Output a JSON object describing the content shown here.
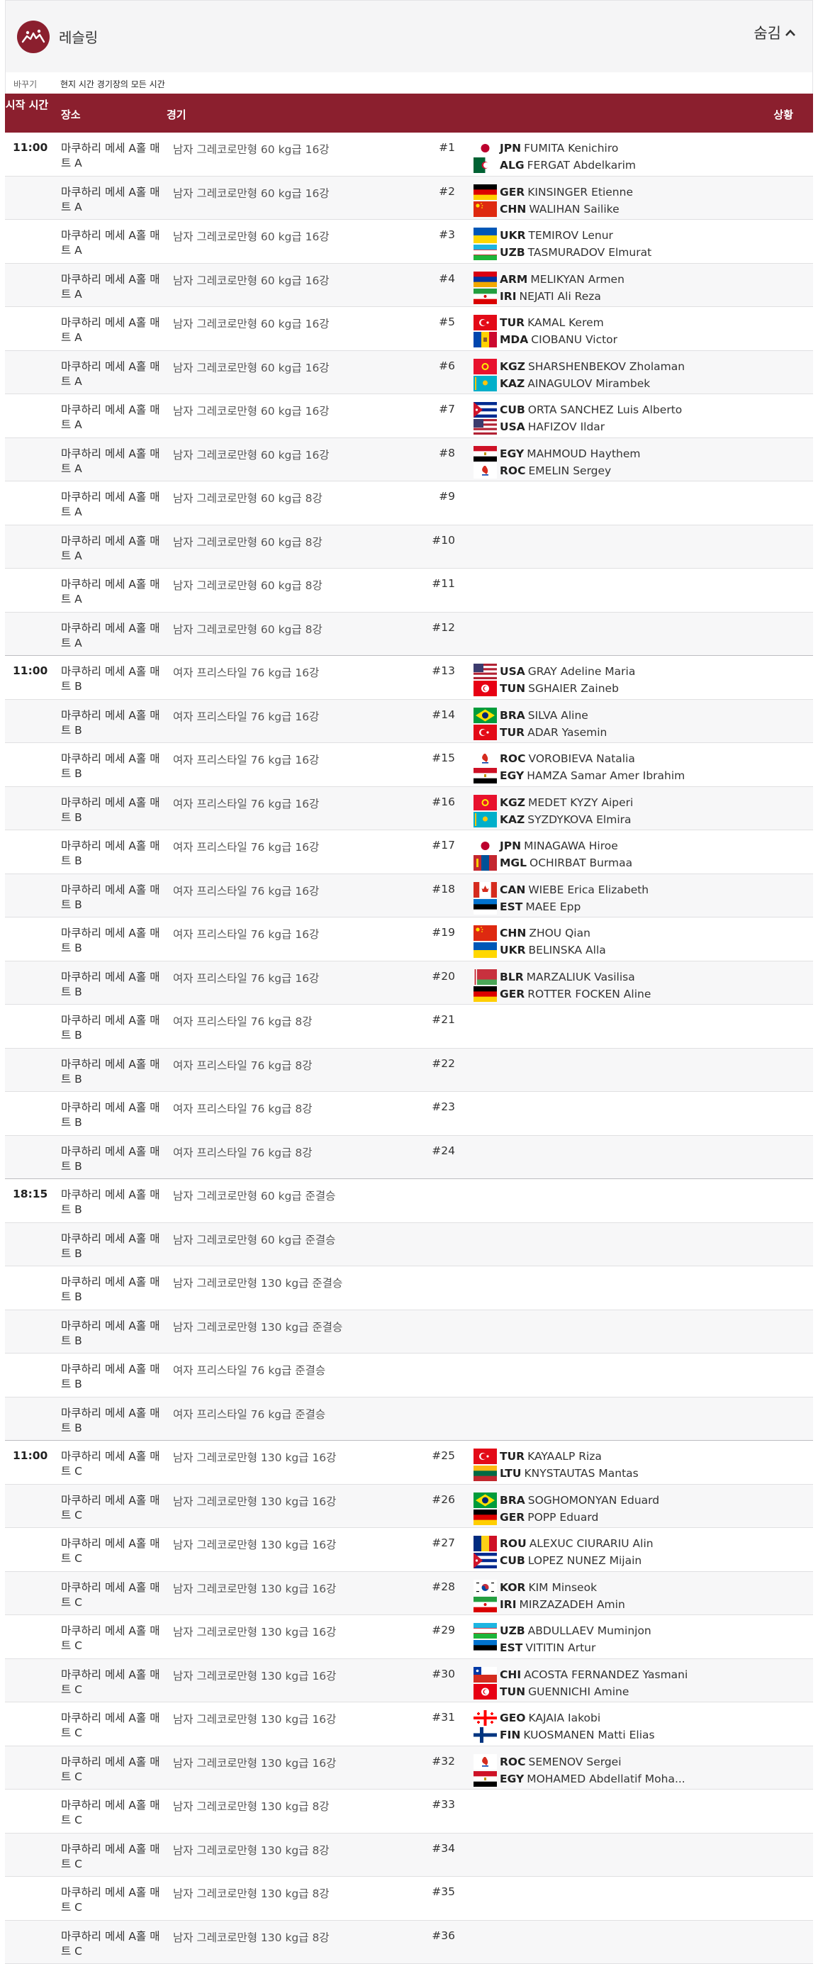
{
  "header": {
    "sport_title": "레슬링",
    "hide_label": "숨김"
  },
  "subbar": {
    "change_label": "바꾸기",
    "timezone_label": "현지 시간 경기장의 모든 시간"
  },
  "table": {
    "headers": {
      "time": "시작 시간",
      "venue": "장소",
      "event": "경기",
      "status": "상황"
    },
    "rows": [
      {
        "time": "11:00",
        "venue": "마쿠하리 메세 A홀 매트 A",
        "event": "남자 그레코로만형 60 kg급 16강",
        "num": "#1",
        "competitors": [
          {
            "flag": "JPN",
            "code": "JPN",
            "name": "FUMITA Kenichiro"
          },
          {
            "flag": "ALG",
            "code": "ALG",
            "name": "FERGAT Abdelkarim"
          }
        ]
      },
      {
        "time": "",
        "venue": "마쿠하리 메세 A홀 매트 A",
        "event": "남자 그레코로만형 60 kg급 16강",
        "num": "#2",
        "competitors": [
          {
            "flag": "GER",
            "code": "GER",
            "name": "KINSINGER Etienne"
          },
          {
            "flag": "CHN",
            "code": "CHN",
            "name": "WALIHAN Sailike"
          }
        ]
      },
      {
        "time": "",
        "venue": "마쿠하리 메세 A홀 매트 A",
        "event": "남자 그레코로만형 60 kg급 16강",
        "num": "#3",
        "competitors": [
          {
            "flag": "UKR",
            "code": "UKR",
            "name": "TEMIROV Lenur"
          },
          {
            "flag": "UZB",
            "code": "UZB",
            "name": "TASMURADOV Elmurat"
          }
        ]
      },
      {
        "time": "",
        "venue": "마쿠하리 메세 A홀 매트 A",
        "event": "남자 그레코로만형 60 kg급 16강",
        "num": "#4",
        "competitors": [
          {
            "flag": "ARM",
            "code": "ARM",
            "name": "MELIKYAN Armen"
          },
          {
            "flag": "IRI",
            "code": "IRI",
            "name": "NEJATI Ali Reza"
          }
        ]
      },
      {
        "time": "",
        "venue": "마쿠하리 메세 A홀 매트 A",
        "event": "남자 그레코로만형 60 kg급 16강",
        "num": "#5",
        "competitors": [
          {
            "flag": "TUR",
            "code": "TUR",
            "name": "KAMAL Kerem"
          },
          {
            "flag": "MDA",
            "code": "MDA",
            "name": "CIOBANU Victor"
          }
        ]
      },
      {
        "time": "",
        "venue": "마쿠하리 메세 A홀 매트 A",
        "event": "남자 그레코로만형 60 kg급 16강",
        "num": "#6",
        "competitors": [
          {
            "flag": "KGZ",
            "code": "KGZ",
            "name": "SHARSHENBEKOV Zholaman"
          },
          {
            "flag": "KAZ",
            "code": "KAZ",
            "name": "AINAGULOV Mirambek"
          }
        ]
      },
      {
        "time": "",
        "venue": "마쿠하리 메세 A홀 매트 A",
        "event": "남자 그레코로만형 60 kg급 16강",
        "num": "#7",
        "competitors": [
          {
            "flag": "CUB",
            "code": "CUB",
            "name": "ORTA SANCHEZ Luis Alberto"
          },
          {
            "flag": "USA",
            "code": "USA",
            "name": "HAFIZOV Ildar"
          }
        ]
      },
      {
        "time": "",
        "venue": "마쿠하리 메세 A홀 매트 A",
        "event": "남자 그레코로만형 60 kg급 16강",
        "num": "#8",
        "competitors": [
          {
            "flag": "EGY",
            "code": "EGY",
            "name": "MAHMOUD Haythem"
          },
          {
            "flag": "ROC",
            "code": "ROC",
            "name": "EMELIN Sergey"
          }
        ]
      },
      {
        "time": "",
        "venue": "마쿠하리 메세 A홀 매트 A",
        "event": "남자 그레코로만형 60 kg급 8강",
        "num": "#9",
        "competitors": []
      },
      {
        "time": "",
        "venue": "마쿠하리 메세 A홀 매트 A",
        "event": "남자 그레코로만형 60 kg급 8강",
        "num": "#10",
        "competitors": []
      },
      {
        "time": "",
        "venue": "마쿠하리 메세 A홀 매트 A",
        "event": "남자 그레코로만형 60 kg급 8강",
        "num": "#11",
        "competitors": []
      },
      {
        "time": "",
        "venue": "마쿠하리 메세 A홀 매트 A",
        "event": "남자 그레코로만형 60 kg급 8강",
        "num": "#12",
        "competitors": []
      },
      {
        "time": "11:00",
        "venue": "마쿠하리 메세 A홀 매트 B",
        "event": "여자 프리스타일 76 kg급 16강",
        "num": "#13",
        "competitors": [
          {
            "flag": "USA",
            "code": "USA",
            "name": "GRAY Adeline Maria"
          },
          {
            "flag": "TUN",
            "code": "TUN",
            "name": "SGHAIER Zaineb"
          }
        ]
      },
      {
        "time": "",
        "venue": "마쿠하리 메세 A홀 매트 B",
        "event": "여자 프리스타일 76 kg급 16강",
        "num": "#14",
        "competitors": [
          {
            "flag": "BRA",
            "code": "BRA",
            "name": "SILVA Aline"
          },
          {
            "flag": "TUR",
            "code": "TUR",
            "name": "ADAR Yasemin"
          }
        ]
      },
      {
        "time": "",
        "venue": "마쿠하리 메세 A홀 매트 B",
        "event": "여자 프리스타일 76 kg급 16강",
        "num": "#15",
        "competitors": [
          {
            "flag": "ROC",
            "code": "ROC",
            "name": "VOROBIEVA Natalia"
          },
          {
            "flag": "EGY",
            "code": "EGY",
            "name": "HAMZA Samar Amer Ibrahim"
          }
        ]
      },
      {
        "time": "",
        "venue": "마쿠하리 메세 A홀 매트 B",
        "event": "여자 프리스타일 76 kg급 16강",
        "num": "#16",
        "competitors": [
          {
            "flag": "KGZ",
            "code": "KGZ",
            "name": "MEDET KYZY Aiperi"
          },
          {
            "flag": "KAZ",
            "code": "KAZ",
            "name": "SYZDYKOVA Elmira"
          }
        ]
      },
      {
        "time": "",
        "venue": "마쿠하리 메세 A홀 매트 B",
        "event": "여자 프리스타일 76 kg급 16강",
        "num": "#17",
        "competitors": [
          {
            "flag": "JPN",
            "code": "JPN",
            "name": "MINAGAWA Hiroe"
          },
          {
            "flag": "MGL",
            "code": "MGL",
            "name": "OCHIRBAT Burmaa"
          }
        ]
      },
      {
        "time": "",
        "venue": "마쿠하리 메세 A홀 매트 B",
        "event": "여자 프리스타일 76 kg급 16강",
        "num": "#18",
        "competitors": [
          {
            "flag": "CAN",
            "code": "CAN",
            "name": "WIEBE Erica Elizabeth"
          },
          {
            "flag": "EST",
            "code": "EST",
            "name": "MAEE Epp"
          }
        ]
      },
      {
        "time": "",
        "venue": "마쿠하리 메세 A홀 매트 B",
        "event": "여자 프리스타일 76 kg급 16강",
        "num": "#19",
        "competitors": [
          {
            "flag": "CHN",
            "code": "CHN",
            "name": "ZHOU Qian"
          },
          {
            "flag": "UKR",
            "code": "UKR",
            "name": "BELINSKA Alla"
          }
        ]
      },
      {
        "time": "",
        "venue": "마쿠하리 메세 A홀 매트 B",
        "event": "여자 프리스타일 76 kg급 16강",
        "num": "#20",
        "competitors": [
          {
            "flag": "BLR",
            "code": "BLR",
            "name": "MARZALIUK Vasilisa"
          },
          {
            "flag": "GER",
            "code": "GER",
            "name": "ROTTER FOCKEN Aline"
          }
        ]
      },
      {
        "time": "",
        "venue": "마쿠하리 메세 A홀 매트 B",
        "event": "여자 프리스타일 76 kg급 8강",
        "num": "#21",
        "competitors": []
      },
      {
        "time": "",
        "venue": "마쿠하리 메세 A홀 매트 B",
        "event": "여자 프리스타일 76 kg급 8강",
        "num": "#22",
        "competitors": []
      },
      {
        "time": "",
        "venue": "마쿠하리 메세 A홀 매트 B",
        "event": "여자 프리스타일 76 kg급 8강",
        "num": "#23",
        "competitors": []
      },
      {
        "time": "",
        "venue": "마쿠하리 메세 A홀 매트 B",
        "event": "여자 프리스타일 76 kg급 8강",
        "num": "#24",
        "competitors": []
      },
      {
        "time": "18:15",
        "venue": "마쿠하리 메세 A홀 매트 B",
        "event": "남자 그레코로만형 60 kg급 준결승",
        "num": "",
        "competitors": []
      },
      {
        "time": "",
        "venue": "마쿠하리 메세 A홀 매트 B",
        "event": "남자 그레코로만형 60 kg급 준결승",
        "num": "",
        "competitors": []
      },
      {
        "time": "",
        "venue": "마쿠하리 메세 A홀 매트 B",
        "event": "남자 그레코로만형 130 kg급 준결승",
        "num": "",
        "competitors": []
      },
      {
        "time": "",
        "venue": "마쿠하리 메세 A홀 매트 B",
        "event": "남자 그레코로만형 130 kg급 준결승",
        "num": "",
        "competitors": []
      },
      {
        "time": "",
        "venue": "마쿠하리 메세 A홀 매트 B",
        "event": "여자 프리스타일 76 kg급 준결승",
        "num": "",
        "competitors": []
      },
      {
        "time": "",
        "venue": "마쿠하리 메세 A홀 매트 B",
        "event": "여자 프리스타일 76 kg급 준결승",
        "num": "",
        "competitors": []
      },
      {
        "time": "11:00",
        "venue": "마쿠하리 메세 A홀 매트 C",
        "event": "남자 그레코로만형 130 kg급 16강",
        "num": "#25",
        "competitors": [
          {
            "flag": "TUR",
            "code": "TUR",
            "name": "KAYAALP Riza"
          },
          {
            "flag": "LTU",
            "code": "LTU",
            "name": "KNYSTAUTAS Mantas"
          }
        ]
      },
      {
        "time": "",
        "venue": "마쿠하리 메세 A홀 매트 C",
        "event": "남자 그레코로만형 130 kg급 16강",
        "num": "#26",
        "competitors": [
          {
            "flag": "BRA",
            "code": "BRA",
            "name": "SOGHOMONYAN Eduard"
          },
          {
            "flag": "GER",
            "code": "GER",
            "name": "POPP Eduard"
          }
        ]
      },
      {
        "time": "",
        "venue": "마쿠하리 메세 A홀 매트 C",
        "event": "남자 그레코로만형 130 kg급 16강",
        "num": "#27",
        "competitors": [
          {
            "flag": "ROU",
            "code": "ROU",
            "name": "ALEXUC CIURARIU Alin"
          },
          {
            "flag": "CUB",
            "code": "CUB",
            "name": "LOPEZ NUNEZ Mijain"
          }
        ]
      },
      {
        "time": "",
        "venue": "마쿠하리 메세 A홀 매트 C",
        "event": "남자 그레코로만형 130 kg급 16강",
        "num": "#28",
        "competitors": [
          {
            "flag": "KOR",
            "code": "KOR",
            "name": "KIM Minseok"
          },
          {
            "flag": "IRI",
            "code": "IRI",
            "name": "MIRZAZADEH Amin"
          }
        ]
      },
      {
        "time": "",
        "venue": "마쿠하리 메세 A홀 매트 C",
        "event": "남자 그레코로만형 130 kg급 16강",
        "num": "#29",
        "competitors": [
          {
            "flag": "UZB",
            "code": "UZB",
            "name": "ABDULLAEV Muminjon"
          },
          {
            "flag": "EST",
            "code": "EST",
            "name": "VITITIN Artur"
          }
        ]
      },
      {
        "time": "",
        "venue": "마쿠하리 메세 A홀 매트 C",
        "event": "남자 그레코로만형 130 kg급 16강",
        "num": "#30",
        "competitors": [
          {
            "flag": "CHI",
            "code": "CHI",
            "name": "ACOSTA FERNANDEZ Yasmani"
          },
          {
            "flag": "TUN",
            "code": "TUN",
            "name": "GUENNICHI Amine"
          }
        ]
      },
      {
        "time": "",
        "venue": "마쿠하리 메세 A홀 매트 C",
        "event": "남자 그레코로만형 130 kg급 16강",
        "num": "#31",
        "competitors": [
          {
            "flag": "GEO",
            "code": "GEO",
            "name": "KAJAIA Iakobi"
          },
          {
            "flag": "FIN",
            "code": "FIN",
            "name": "KUOSMANEN Matti Elias"
          }
        ]
      },
      {
        "time": "",
        "venue": "마쿠하리 메세 A홀 매트 C",
        "event": "남자 그레코로만형 130 kg급 16강",
        "num": "#32",
        "competitors": [
          {
            "flag": "ROC",
            "code": "ROC",
            "name": "SEMENOV Sergei"
          },
          {
            "flag": "EGY",
            "code": "EGY",
            "name": "MOHAMED Abdellatif Moha..."
          }
        ]
      },
      {
        "time": "",
        "venue": "마쿠하리 메세 A홀 매트 C",
        "event": "남자 그레코로만형 130 kg급 8강",
        "num": "#33",
        "competitors": []
      },
      {
        "time": "",
        "venue": "마쿠하리 메세 A홀 매트 C",
        "event": "남자 그레코로만형 130 kg급 8강",
        "num": "#34",
        "competitors": []
      },
      {
        "time": "",
        "venue": "마쿠하리 메세 A홀 매트 C",
        "event": "남자 그레코로만형 130 kg급 8강",
        "num": "#35",
        "competitors": []
      },
      {
        "time": "",
        "venue": "마쿠하리 메세 A홀 매트 C",
        "event": "남자 그레코로만형 130 kg급 8강",
        "num": "#36",
        "competitors": []
      }
    ]
  },
  "colors": {
    "accent": "#8b1f2e",
    "header_text": "#ffffff",
    "row_alt": "#f7f7f8"
  },
  "icons": {
    "sport": "wrestling-pictogram-icon",
    "hide": "chevron-up-icon"
  }
}
